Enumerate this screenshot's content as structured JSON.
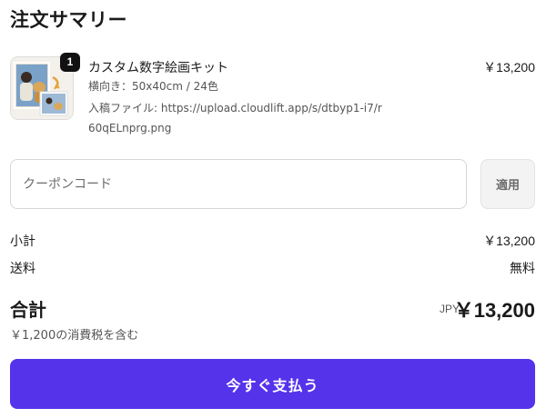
{
  "summary": {
    "title": "注文サマリー"
  },
  "item": {
    "quantity": "1",
    "name": "カスタム数字絵画キット",
    "price": "￥13,200",
    "variant": "横向き：50x40cm / 24色",
    "file": "入稿ファイル: https://upload.cloudlift.app/s/dtbyp1-i7/r60qELnprg.png"
  },
  "coupon": {
    "placeholder": "クーポンコード",
    "apply_label": "適用"
  },
  "totals": {
    "subtotal_label": "小計",
    "subtotal_value": "￥13,200",
    "shipping_label": "送料",
    "shipping_value": "無料",
    "total_label": "合計",
    "currency": "JPY",
    "total_value": "￥13,200",
    "tax_note": "￥1,200の消費税を含む"
  },
  "checkout": {
    "pay_label": "今すぐ支払う"
  }
}
